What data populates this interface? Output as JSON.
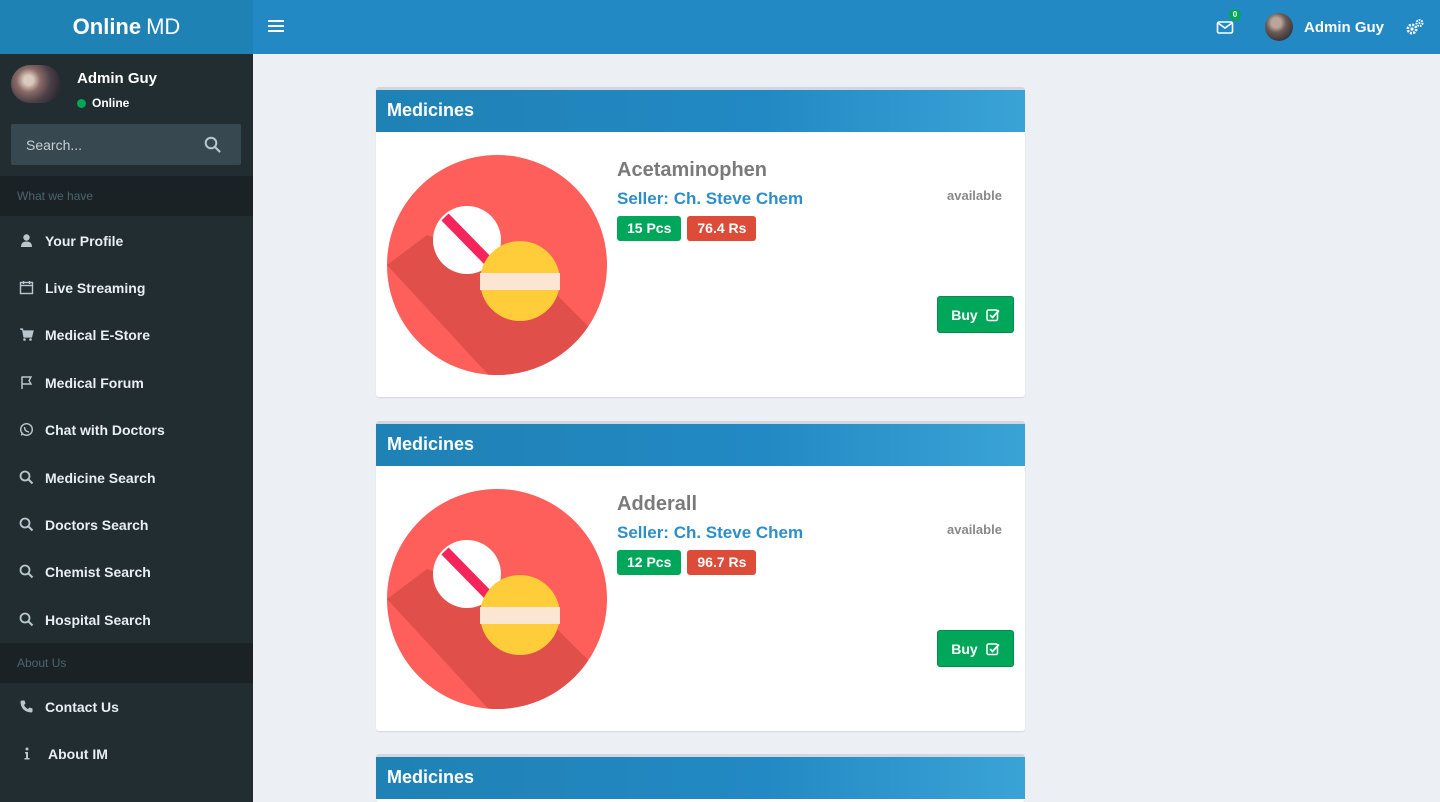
{
  "brand": {
    "bold": "Online",
    "light": "MD"
  },
  "header": {
    "mail_count": "0",
    "user_name": "Admin Guy"
  },
  "sidebar": {
    "user_name": "Admin Guy",
    "status": "Online",
    "search_placeholder": "Search...",
    "section1": "What we have",
    "items": [
      {
        "label": "Your Profile",
        "icon": "user-icon"
      },
      {
        "label": "Live Streaming",
        "icon": "calendar-icon"
      },
      {
        "label": "Medical E-Store",
        "icon": "cart-icon"
      },
      {
        "label": "Medical Forum",
        "icon": "flag-icon"
      },
      {
        "label": "Chat with Doctors",
        "icon": "whatsapp-icon"
      },
      {
        "label": "Medicine Search",
        "icon": "search-icon"
      },
      {
        "label": "Doctors Search",
        "icon": "search-icon"
      },
      {
        "label": "Chemist Search",
        "icon": "search-icon"
      },
      {
        "label": "Hospital Search",
        "icon": "search-icon"
      }
    ],
    "section2": "About Us",
    "items2": [
      {
        "label": "Contact Us",
        "icon": "phone-icon"
      },
      {
        "label": "About IM",
        "icon": "info-icon"
      }
    ]
  },
  "cards": [
    {
      "header": "Medicines",
      "name": "Acetaminophen",
      "seller": "Seller: Ch. Steve Chem",
      "qty": "15 Pcs",
      "price": "76.4 Rs",
      "availability": "available",
      "buy_label": "Buy"
    },
    {
      "header": "Medicines",
      "name": "Adderall",
      "seller": "Seller: Ch. Steve Chem",
      "qty": "12 Pcs",
      "price": "96.7 Rs",
      "availability": "available",
      "buy_label": "Buy"
    },
    {
      "header": "Medicines"
    }
  ],
  "colors": {
    "brand_blue": "#2389c4",
    "sidebar_bg": "#222d32",
    "success": "#00a65a",
    "danger": "#dd4b39",
    "pill_circle": "#fe5f5a"
  }
}
